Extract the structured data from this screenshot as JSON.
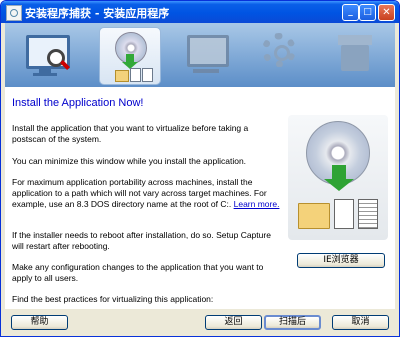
{
  "window": {
    "title": "安装程序捕获 - 安装应用程序",
    "buttons": [
      "minimize",
      "maximize",
      "close"
    ]
  },
  "steps": [
    {
      "icon": "monitor-magnifier-icon",
      "active": false
    },
    {
      "icon": "cd-install-icon",
      "active": true
    },
    {
      "icon": "monitor-icon",
      "active": false
    },
    {
      "icon": "gear-icon",
      "active": false
    },
    {
      "icon": "package-icon",
      "active": false
    }
  ],
  "main": {
    "heading": "Install the Application Now!",
    "p1": "Install the application that you want to virtualize before taking a postscan of the system.",
    "p2": "You can minimize this window while you install the application.",
    "p3": "For maximum application portability across machines, install the application to a path which will not vary across target machines. For example, use an 8.3 DOS directory name at the root of C:.",
    "learn_more": "Learn more.",
    "p4": "If the installer needs to reboot after installation, do so. Setup Capture will restart after rebooting.",
    "p5": "Make any configuration changes to the application that you want to apply to all users.",
    "p6": "Find the best practices for virtualizing this application:",
    "ie_button": "IE浏览器"
  },
  "footer": {
    "help": "帮助",
    "back": "返回",
    "postscan": "扫描后",
    "cancel": "取消"
  },
  "colors": {
    "title_bar": "#0054e3",
    "heading": "#0000cc",
    "step_bar": "#5c8ec8"
  }
}
